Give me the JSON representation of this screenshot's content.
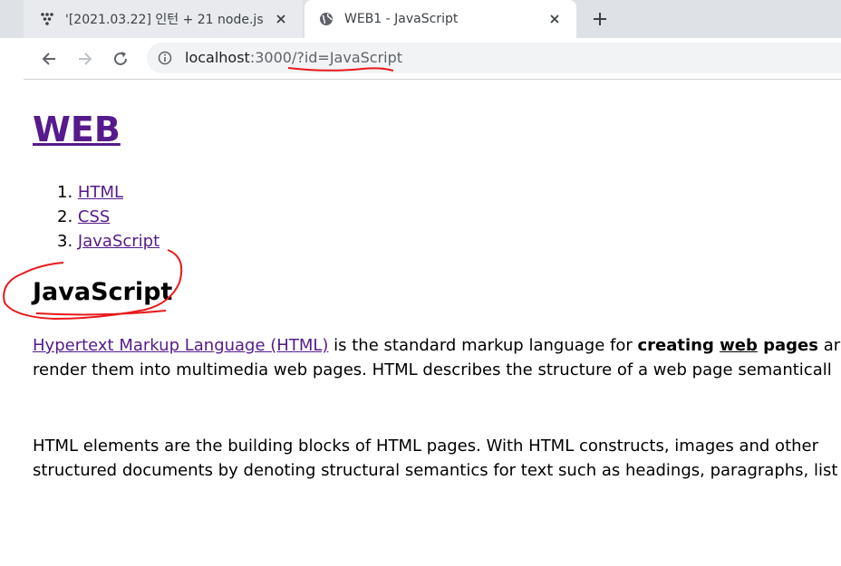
{
  "browser": {
    "tabs": [
      {
        "title": "'[2021.03.22] 인턴 + 21 node.js",
        "favicon": "dots-icon",
        "active": false
      },
      {
        "title": "WEB1 - JavaScript",
        "favicon": "globe-icon",
        "active": true
      }
    ],
    "address": {
      "host": "localhost",
      "rest": ":3000/?id=JavaScript"
    }
  },
  "page": {
    "heading": "WEB",
    "nav": [
      {
        "number": "1.",
        "label": "HTML"
      },
      {
        "number": "2.",
        "label": "CSS"
      },
      {
        "number": "3.",
        "label": "JavaScript"
      }
    ],
    "subheading": "JavaScript",
    "paragraph1": {
      "line1": {
        "link": "Hypertext Markup Language (HTML)",
        "text1": " is the standard markup language for ",
        "bold1": "creating ",
        "bold_underline": "web",
        "bold2": " pages",
        "text2": " ar"
      },
      "line2": "render them into multimedia web pages. HTML describes the structure of a web page semanticall"
    },
    "paragraph2": {
      "line1": "HTML elements are the building blocks of HTML pages. With HTML constructs, images and other",
      "line2": "structured documents by denoting structural semantics for text such as headings, paragraphs, list"
    }
  },
  "colors": {
    "annotation": "#e8191b",
    "link_visited": "#551a8b"
  }
}
